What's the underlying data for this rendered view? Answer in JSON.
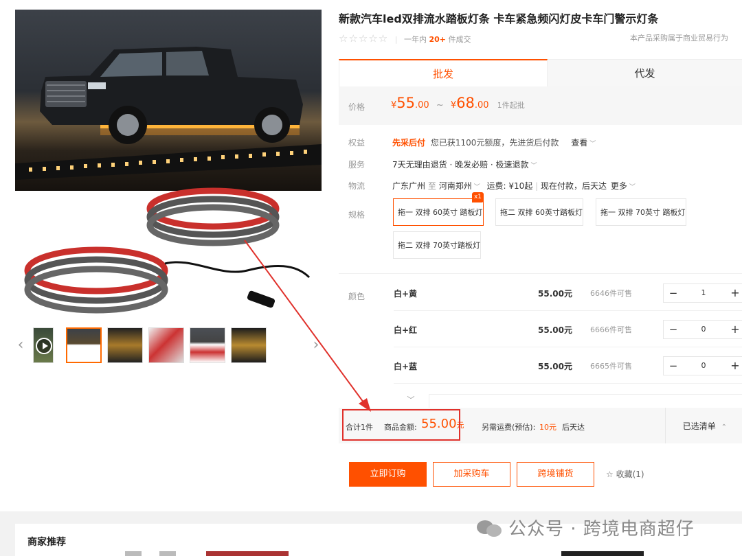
{
  "product": {
    "title": "新款汽车led双排流水踏板灯条 卡车紧急频闪灯皮卡车门警示灯条",
    "stars": "☆☆☆☆☆",
    "sales_prefix": "一年内",
    "sales_count": "20+",
    "sales_suffix": "件成交",
    "trade_note": "本产品采购属于商业贸易行为"
  },
  "tabs": [
    {
      "label": "批发",
      "active": true
    },
    {
      "label": "代发",
      "active": false
    }
  ],
  "price": {
    "label": "价格",
    "currency": "¥",
    "low_int": "55",
    "low_dec": ".00",
    "tilde": "~",
    "high_int": "68",
    "high_dec": ".00",
    "min_order": "1件起批"
  },
  "benefits": {
    "label": "权益",
    "tag": "先采后付",
    "text": "您已获1100元额度，先进货后付款",
    "link": "查看"
  },
  "service": {
    "label": "服务",
    "text": "7天无理由退货 · 晚发必赔 · 极速退款"
  },
  "logistics": {
    "label": "物流",
    "from": "广东广州",
    "to_word": "至",
    "to": "河南郑州",
    "fee": "运费: ¥10起",
    "pay": "现在付款，后天达",
    "more": "更多"
  },
  "specs": {
    "label": "规格",
    "options": [
      {
        "text": "拖一 双排 60英寸 踏板灯",
        "selected": true,
        "badge": "x1"
      },
      {
        "text": "拖二 双排 60英寸踏板灯",
        "selected": false
      },
      {
        "text": "拖一 双排 70英寸 踏板灯",
        "selected": false
      },
      {
        "text": "拖二 双排 70英寸踏板灯",
        "selected": false
      }
    ]
  },
  "colors": {
    "label": "颜色",
    "items": [
      {
        "name": "白+黄",
        "price": "55.00元",
        "stock": "6646件可售",
        "qty": "1"
      },
      {
        "name": "白+红",
        "price": "55.00元",
        "stock": "6666件可售",
        "qty": "0"
      },
      {
        "name": "白+蓝",
        "price": "55.00元",
        "stock": "6665件可售",
        "qty": "0"
      }
    ],
    "minus": "−",
    "plus": "+",
    "collapse_icon": "﹀"
  },
  "summary": {
    "total_count": "合计1件",
    "amount_label": "商品金额:",
    "amount": "55.00",
    "amount_unit": "元",
    "shipping_label": "另需运费(预估):",
    "shipping_fee": "10元",
    "eta": "后天达",
    "selected_list": "已选清单",
    "chevron": "⌃"
  },
  "actions": {
    "buy_now": "立即订购",
    "add_cart": "加采购车",
    "cross_border": "跨境铺货",
    "favorite": "收藏(1)",
    "star": "☆"
  },
  "recommend": {
    "title": "商家推荐"
  },
  "watermark": {
    "text": "公众号 · 跨境电商超仔"
  },
  "gallery": {
    "prev": "‹",
    "next": "›"
  },
  "colors_theme": {
    "accent": "#ff5000",
    "highlight": "#e0312b"
  }
}
